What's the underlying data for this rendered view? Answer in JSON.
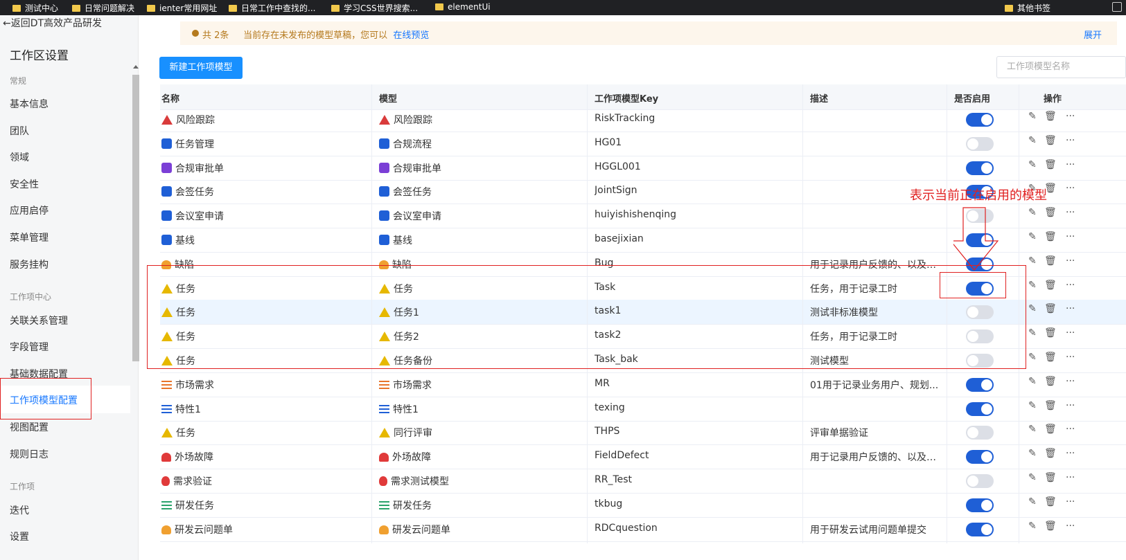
{
  "bookmarks": {
    "items": [
      "测试中心",
      "日常问题解决",
      "ienter常用网址",
      "日常工作中查找的...",
      "学习CSS世界搜索...",
      "elementUi"
    ],
    "other": "其他书签"
  },
  "sidebar": {
    "back": "←返回DT高效产品研发",
    "title": "工作区设置",
    "group_general": "常规",
    "general_items": [
      "基本信息",
      "团队",
      "领域",
      "安全性",
      "应用启停",
      "菜单管理",
      "服务挂构"
    ],
    "group_workitem": "工作项中心",
    "workitem_items": [
      "关联关系管理",
      "字段管理",
      "基础数据配置",
      "工作项模型配置",
      "视图配置",
      "规则日志"
    ],
    "group_work": "工作项",
    "work_items": [
      "迭代",
      "设置"
    ]
  },
  "notice": {
    "count": "共 2条",
    "text": "当前存在未发布的模型草稿，您可以",
    "link": "在线预览",
    "expand": "展开"
  },
  "toolbar": {
    "new_button": "新建工作项模型",
    "search_placeholder": "工作项模型名称"
  },
  "table": {
    "headers": [
      "名称",
      "模型",
      "工作项模型Key",
      "描述",
      "是否启用",
      "操作"
    ],
    "rows": [
      {
        "name": "风险跟踪",
        "model": "风险跟踪",
        "key": "RiskTracking",
        "desc": "",
        "enabled": true,
        "icon": "warning-red"
      },
      {
        "name": "任务管理",
        "model": "合规流程",
        "key": "HG01",
        "desc": "",
        "enabled": false,
        "icon": "edit-blue"
      },
      {
        "name": "合规审批单",
        "model": "合规审批单",
        "key": "HGGL001",
        "desc": "",
        "enabled": true,
        "icon": "edit-purple"
      },
      {
        "name": "会签任务",
        "model": "会签任务",
        "key": "JointSign",
        "desc": "",
        "enabled": true,
        "icon": "edit-blue"
      },
      {
        "name": "会议室申请",
        "model": "会议室申请",
        "key": "huiyishishenqing",
        "desc": "",
        "enabled": false,
        "icon": "edit-blue"
      },
      {
        "name": "基线",
        "model": "基线",
        "key": "basejixian",
        "desc": "",
        "enabled": true,
        "icon": "edit-blue"
      },
      {
        "name": "缺陷",
        "model": "缺陷",
        "key": "Bug",
        "desc": "用于记录用户反馈的、以及开...",
        "enabled": true,
        "icon": "bug-orange"
      },
      {
        "name": "任务",
        "model": "任务",
        "key": "Task",
        "desc": "任务，用于记录工时",
        "enabled": true,
        "icon": "warning-yellow"
      },
      {
        "name": "任务",
        "model": "任务1",
        "key": "task1",
        "desc": "测试非标准模型",
        "enabled": false,
        "icon": "warning-yellow"
      },
      {
        "name": "任务",
        "model": "任务2",
        "key": "task2",
        "desc": "任务，用于记录工时",
        "enabled": false,
        "icon": "warning-yellow"
      },
      {
        "name": "任务",
        "model": "任务备份",
        "key": "Task_bak",
        "desc": "测试模型",
        "enabled": false,
        "icon": "warning-yellow"
      },
      {
        "name": "市场需求",
        "model": "市场需求",
        "key": "MR",
        "desc": "01用于记录业务用户、规划...",
        "enabled": true,
        "icon": "list-orange"
      },
      {
        "name": "特性1",
        "model": "特性1",
        "key": "texing",
        "desc": "",
        "enabled": true,
        "icon": "list-blue"
      },
      {
        "name": "任务",
        "model": "同行评审",
        "key": "THPS",
        "desc": "评审单据验证",
        "enabled": false,
        "icon": "warning-yellow"
      },
      {
        "name": "外场故障",
        "model": "外场故障",
        "key": "FieldDefect",
        "desc": "用于记录用户反馈的、以及开...",
        "enabled": true,
        "icon": "alarm-red"
      },
      {
        "name": "需求验证",
        "model": "需求测试模型",
        "key": "RR_Test",
        "desc": "",
        "enabled": false,
        "icon": "bulb-red"
      },
      {
        "name": "研发任务",
        "model": "研发任务",
        "key": "tkbug",
        "desc": "",
        "enabled": true,
        "icon": "list-green"
      },
      {
        "name": "研发云问题单",
        "model": "研发云问题单",
        "key": "RDCquestion",
        "desc": "用于研发云试用问题单提交",
        "enabled": true,
        "icon": "bug-orange"
      }
    ],
    "actions": {
      "edit": "edit-icon",
      "delete": "delete-icon",
      "more": "···"
    }
  },
  "annotation": {
    "text": "表示当前正在启用的模型",
    "color": "#e02020"
  },
  "colors": {
    "primary": "#1890ff",
    "switch_on": "#1f5fd6",
    "switch_off": "#dcdfe6",
    "notice_bg": "#fdf6ec",
    "row_highlight": "#ecf5ff"
  }
}
